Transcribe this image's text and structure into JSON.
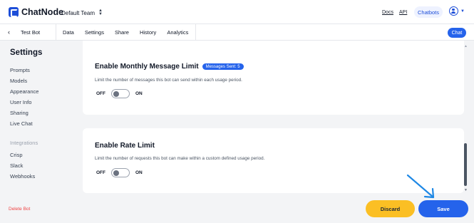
{
  "header": {
    "logo_text": "ChatNode",
    "team_name": "Default Team",
    "links": [
      "Docs",
      "API"
    ],
    "chatbots_label": "Chatbots",
    "account_icon": "user-circle-icon"
  },
  "subnav": {
    "back_glyph": "‹",
    "bot_name": "Test Bot",
    "tabs": [
      "Data",
      "Settings",
      "Share",
      "History",
      "Analytics"
    ],
    "chat_label": "Chat"
  },
  "sidebar": {
    "title": "Settings",
    "items": [
      "Prompts",
      "Models",
      "Appearance",
      "User Info",
      "Sharing",
      "Live Chat"
    ],
    "integrations_heading": "Integrations",
    "integrations": [
      "Crisp",
      "Slack",
      "Webhooks"
    ],
    "delete_label": "Delete Bot"
  },
  "cards": {
    "monthly": {
      "title": "Enable Monthly Message Limit",
      "badge": "Messages Sent: 5",
      "description": "Limit the number of messages this bot can send within each usage period.",
      "off_label": "OFF",
      "on_label": "ON",
      "enabled": false
    },
    "rate": {
      "title": "Enable Rate Limit",
      "description": "Limit the number of requests this bot can make within a custom defined usage period.",
      "off_label": "OFF",
      "on_label": "ON",
      "enabled": false
    }
  },
  "actions": {
    "discard_label": "Discard",
    "save_label": "Save"
  },
  "colors": {
    "accent": "#2563eb",
    "discard": "#fbbf24",
    "danger": "#ef4444",
    "annotation_arrow": "#1e88e5"
  }
}
